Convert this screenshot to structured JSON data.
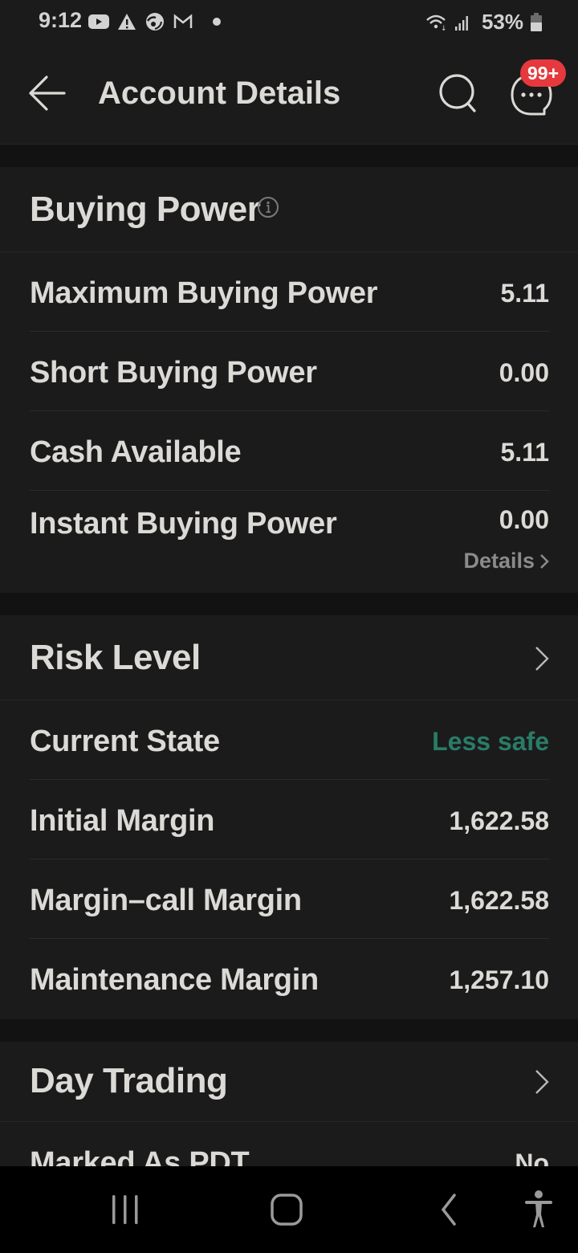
{
  "status_bar": {
    "time": "9:12",
    "notification_icons": [
      "youtube-icon",
      "warning-icon",
      "sync-app-icon",
      "gmail-icon",
      "dot-icon"
    ],
    "wifi": "wifi-icon",
    "signal": "signal-icon",
    "battery_percent": "53%"
  },
  "header": {
    "title": "Account Details",
    "back_icon": "back-arrow-icon",
    "search_icon": "search-icon",
    "messages_icon": "chat-bubble-icon",
    "messages_badge": "99+"
  },
  "buying_power": {
    "title": "Buying Power",
    "rows": [
      {
        "label": "Maximum Buying Power",
        "value": "5.11"
      },
      {
        "label": "Short Buying Power",
        "value": "0.00"
      },
      {
        "label": "Cash Available",
        "value": "5.11"
      },
      {
        "label": "Instant Buying Power",
        "value": "0.00",
        "link": "Details"
      }
    ]
  },
  "risk_level": {
    "title": "Risk Level",
    "rows": [
      {
        "label": "Current State",
        "value": "Less safe",
        "value_color": "#2a7c66"
      },
      {
        "label": "Initial Margin",
        "value": "1,622.58"
      },
      {
        "label": "Margin–call Margin",
        "value": "1,622.58"
      },
      {
        "label": "Maintenance Margin",
        "value": "1,257.10"
      }
    ]
  },
  "day_trading": {
    "title": "Day Trading",
    "rows": [
      {
        "label": "Marked As PDT",
        "value": "No"
      }
    ]
  },
  "nav_bar": {
    "buttons": [
      "recent-apps",
      "home",
      "back",
      "accessibility"
    ]
  }
}
